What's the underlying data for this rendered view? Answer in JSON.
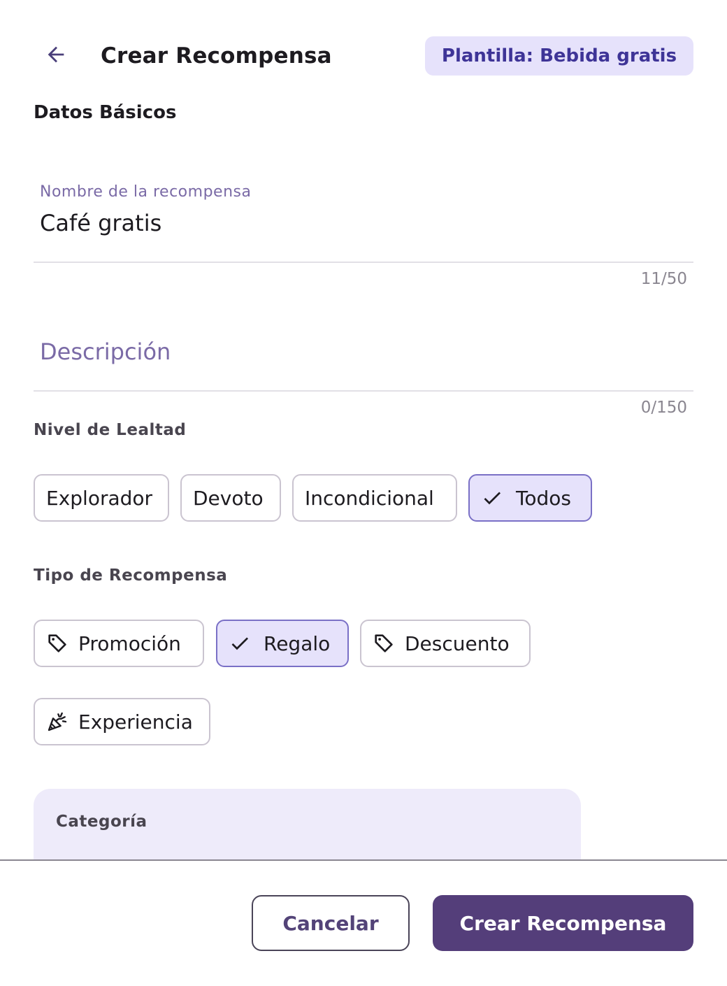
{
  "header": {
    "title": "Crear Recompensa",
    "template_badge": "Plantilla: Bebida gratis",
    "back_icon": "arrow-back-icon"
  },
  "section_title": "Datos Básicos",
  "name_field": {
    "label": "Nombre de la recompensa",
    "value": "Café gratis",
    "counter": "11/50"
  },
  "description_field": {
    "placeholder": "Descripción",
    "counter": "0/150"
  },
  "loyalty_level": {
    "label": "Nivel de Lealtad",
    "options": [
      {
        "label": "Explorador",
        "selected": false
      },
      {
        "label": "Devoto",
        "selected": false
      },
      {
        "label": "Incondicional",
        "selected": false
      },
      {
        "label": "Todos",
        "selected": true
      }
    ]
  },
  "reward_type": {
    "label": "Tipo de Recompensa",
    "options": [
      {
        "label": "Promoción",
        "icon": "tag-icon",
        "selected": false
      },
      {
        "label": "Regalo",
        "icon": "check-icon",
        "selected": true
      },
      {
        "label": "Descuento",
        "icon": "tag-icon",
        "selected": false
      },
      {
        "label": "Experiencia",
        "icon": "celebration-icon",
        "selected": false
      }
    ]
  },
  "category": {
    "label": "Categoría"
  },
  "footer": {
    "cancel_label": "Cancelar",
    "create_label": "Crear Recompensa"
  },
  "colors": {
    "primary": "#543e7a",
    "selected_chip_bg": "#e6e2fb",
    "badge_text": "#3e3497",
    "label_purple": "#7a6aa6"
  }
}
